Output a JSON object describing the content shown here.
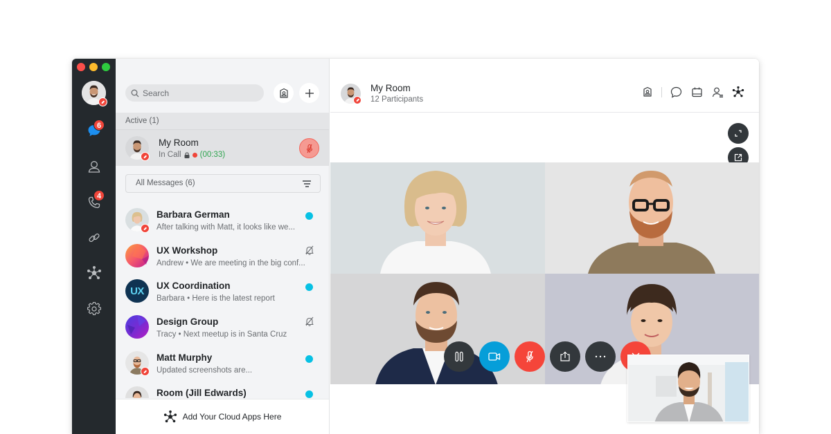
{
  "window": {
    "traffic_lights": [
      "close",
      "minimize",
      "zoom"
    ]
  },
  "rail": {
    "items": [
      {
        "name": "messages",
        "icon": "chat-bubble-icon",
        "badge": "6",
        "active": true
      },
      {
        "name": "people",
        "icon": "person-icon"
      },
      {
        "name": "calls",
        "icon": "phone-icon",
        "badge": "4"
      },
      {
        "name": "links",
        "icon": "link-icon"
      },
      {
        "name": "apps",
        "icon": "hub-icon"
      },
      {
        "name": "settings",
        "icon": "gear-icon"
      }
    ]
  },
  "list": {
    "search_placeholder": "Search",
    "active_section": "Active (1)",
    "active_call": {
      "title": "My Room",
      "status": "In Call",
      "timer": "(00:33)"
    },
    "filter_label": "All Messages (6)",
    "messages": [
      {
        "title": "Barbara German",
        "preview": "After talking with Matt, it looks like we...",
        "indicator": "unread"
      },
      {
        "title": "UX Workshop",
        "preview": "Andrew • We are meeting in the big conf...",
        "indicator": "muted"
      },
      {
        "title": "UX Coordination",
        "preview": "Barbara • Here is the latest report",
        "indicator": "unread",
        "avatar_text": "UX"
      },
      {
        "title": "Design Group",
        "preview": "Tracy • Next meetup is in Santa Cruz",
        "indicator": "muted"
      },
      {
        "title": "Matt Murphy",
        "preview": "Updated screenshots are...",
        "indicator": "unread"
      },
      {
        "title": "Room (Jill Edwards)",
        "preview": "",
        "indicator": "unread"
      }
    ],
    "cloud_apps_label": "Add Your Cloud Apps Here"
  },
  "main": {
    "title": "My Room",
    "subtitle": "12 Participants",
    "header_icons": [
      "contacts-icon",
      "chat-icon",
      "calendar-icon",
      "participants-icon",
      "apps-icon"
    ],
    "call_controls": [
      "hold",
      "video",
      "mute",
      "share",
      "more",
      "end-call"
    ]
  },
  "colors": {
    "rail": "#24292d",
    "accent_blue": "#069ed9",
    "alert_red": "#f5453a",
    "unread": "#07c1e4",
    "timer_green": "#2ea44f"
  }
}
